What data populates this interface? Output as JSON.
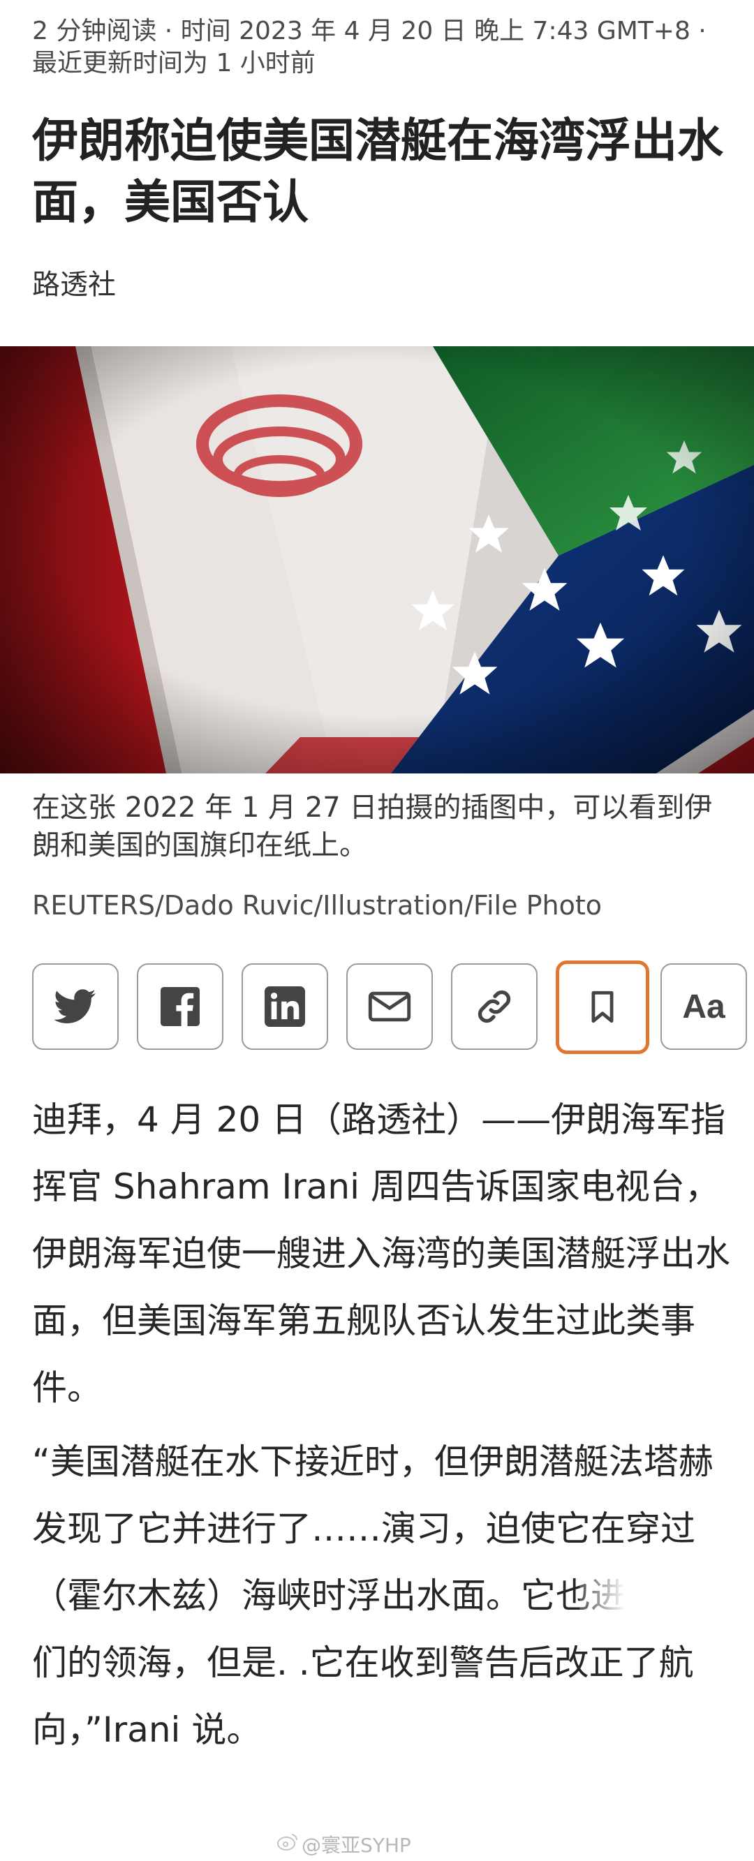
{
  "article": {
    "meta_line1": "2 分钟阅读 · 时间 2023 年 4 月 20 日 晚上 7:43 GMT+8 ·",
    "meta_line2": "最近更新时间为 1 小时前",
    "headline": "伊朗称迫使美国潜艇在海湾浮出水面，美国否认",
    "byline": "路透社"
  },
  "photo": {
    "caption": "在这张 2022 年 1 月 27 日拍摄的插图中，可以看到伊朗和美国的国旗印在纸上。",
    "credit": "REUTERS/Dado Ruvic/Illustration/File Photo"
  },
  "share_bar": {
    "buttons": [
      {
        "id": "twitter",
        "icon": "twitter-icon"
      },
      {
        "id": "facebook",
        "icon": "facebook-icon"
      },
      {
        "id": "linkedin",
        "icon": "linkedin-icon"
      },
      {
        "id": "email",
        "icon": "email-icon"
      },
      {
        "id": "link",
        "icon": "link-icon"
      },
      {
        "id": "bookmark",
        "icon": "bookmark-icon",
        "active": true
      },
      {
        "id": "text-size",
        "label": "Aa"
      }
    ],
    "active_color": "#e0762f"
  },
  "body": {
    "p1": "迪拜，4 月 20 日（路透社）——伊朗海军指挥官 Shahram Irani 周四告诉国家电视台，伊朗海军迫使一艘进入海湾的美国潜艇浮出水面，但美国海军第五舰队否认发生过此类事件。",
    "p2": "“美国潜艇在水下接近时，但伊朗潜艇法塔赫发现了它并进行了……演习，迫使它在穿过（霍尔木兹）海峡时浮出水面。它也进入了我们的领海，但是. .它在收到警告后改正了航向，”Irani 说。"
  },
  "watermark": {
    "text": "@寰亚SYHP"
  }
}
